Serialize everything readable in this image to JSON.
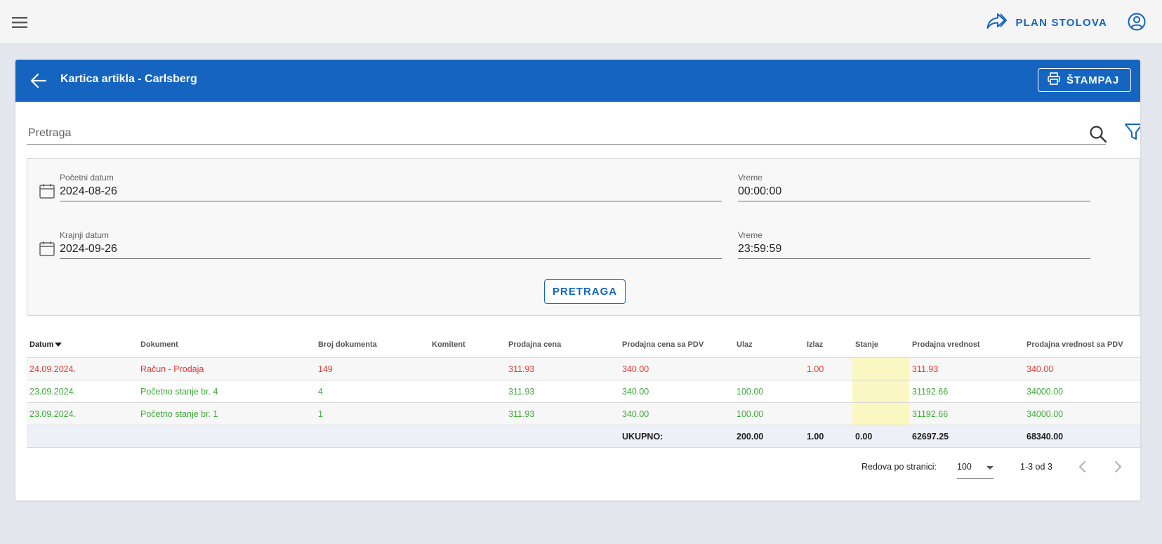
{
  "topbar": {
    "plan_label": "PLAN STOLOVA"
  },
  "header": {
    "title": "Kartica artikla - Carlsberg",
    "print_label": "ŠTAMPAJ"
  },
  "search": {
    "placeholder": "Pretraga",
    "value": ""
  },
  "filters": {
    "start_date_label": "Početni datum",
    "start_date": "2024-08-26",
    "start_time_label": "Vreme",
    "start_time": "00:00:00",
    "end_date_label": "Krajnji datum",
    "end_date": "2024-09-26",
    "end_time_label": "Vreme",
    "end_time": "23:59:59",
    "search_button": "PRETRAGA"
  },
  "table": {
    "columns": [
      "Datum",
      "Dokument",
      "Broj dokumenta",
      "Komitent",
      "Prodajna cena",
      "Prodajna cena sa PDV",
      "Ulaz",
      "Izlaz",
      "Stanje",
      "Prodajna vrednost",
      "Prodajna vrednost sa PDV"
    ],
    "rows": [
      [
        "24.09.2024.",
        "Račun - Prodaja",
        "149",
        "",
        "311.93",
        "340.00",
        "",
        "1.00",
        "",
        "311.93",
        "340.00"
      ],
      [
        "23.09.2024.",
        "Početno stanje br. 4",
        "4",
        "",
        "311.93",
        "340.00",
        "100.00",
        "",
        "",
        "31192.66",
        "34000.00"
      ],
      [
        "23.09.2024.",
        "Početno stanje br. 1",
        "1",
        "",
        "311.93",
        "340.00",
        "100.00",
        "",
        "",
        "31192.66",
        "34000.00"
      ]
    ],
    "row_status_colors": {
      "red": "#e53935",
      "green": "#3faa3a"
    },
    "totals": {
      "label": "UKUPNO:",
      "ulaz": "200.00",
      "izlaz": "1.00",
      "stanje": "0.00",
      "prodajna_vrednost": "62697.25",
      "prodajna_vrednost_pdv": "68340.00"
    }
  },
  "pagination": {
    "rows_per_page_label": "Redova po stranici:",
    "rows_per_page": "100",
    "range": "1-3 od 3"
  },
  "colors": {
    "primary": "#1565c0",
    "stanje_highlight": "#fbf7c2"
  }
}
